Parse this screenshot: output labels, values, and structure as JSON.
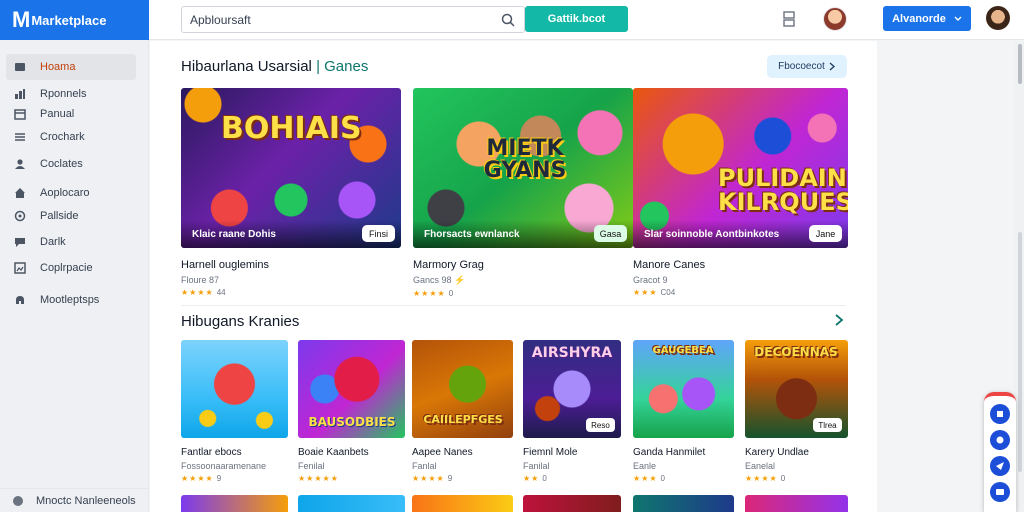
{
  "header": {
    "brand_mark": "M",
    "brand_name": "Marketplace",
    "search_value": "Apbloursaft",
    "green_button": "Gattik.bcot",
    "blue_button": "Alvanorde",
    "colors": {
      "brand": "#1a73e8",
      "teal": "#14b8a6"
    }
  },
  "sidebar": {
    "items": [
      {
        "label": "Hoama",
        "icon": "home-icon",
        "active": true
      },
      {
        "label": "Rponnels",
        "icon": "chart-icon"
      },
      {
        "label": "Panual",
        "icon": "calendar-icon"
      },
      {
        "label": "Crochark",
        "icon": "list-icon"
      },
      {
        "label": "Coclates",
        "icon": "user-icon"
      },
      {
        "label": "Aoplocaro",
        "icon": "house-icon"
      },
      {
        "label": "Pallside",
        "icon": "location-icon"
      },
      {
        "label": "Darlk",
        "icon": "chat-icon"
      },
      {
        "label": "Coplrpacie",
        "icon": "image-icon"
      },
      {
        "label": "Mootleptsps",
        "icon": "cloud-icon"
      }
    ],
    "footer": "Mnoctc Nanleeneols"
  },
  "featured": {
    "title": "Hibaurlana Usarsial",
    "title_accent": "| Ganes",
    "see_all": "Fbocoecot",
    "cards": [
      {
        "art": "BOHIAIS",
        "caption": "Klaic raane Dohis",
        "badge": "Finsi",
        "title": "Harnell ouglemins",
        "sub": "Floure 87",
        "rating": "44",
        "stars": "★★★★"
      },
      {
        "art": "MIETK GYANS",
        "caption": "Fhorsacts ewnlanck",
        "badge": "Gasa",
        "title": "Marmory Grag",
        "sub": "Gancs 98 ⚡",
        "rating": "0",
        "stars": "★★★★"
      },
      {
        "art": "PULIDAIN KILRQUES",
        "caption": "Slar soinnoble Aontbinkotes",
        "badge": "Jane",
        "title": "Manore Canes",
        "sub": "Gracot 9",
        "rating": "C04",
        "stars": "★★★"
      }
    ]
  },
  "games": {
    "title": "Hibugans Kranies",
    "cards": [
      {
        "art": "",
        "title": "Fantlar ebocs",
        "sub": "Fossoonaaramenane",
        "rating": "9",
        "stars": "★★★★"
      },
      {
        "art": "BAUSODBIES",
        "title": "Boaie Kaanbets",
        "sub": "Fenilal",
        "rating": "",
        "stars": "★★★★★"
      },
      {
        "art": "CAIILEPFGES",
        "title": "Aapee Nanes",
        "sub": "Fanlal",
        "rating": "9",
        "stars": "★★★★"
      },
      {
        "art": "AIRSHYRA",
        "badge": "Reso",
        "title": "Fiemnl Mole",
        "sub": "Fanilal",
        "rating": "0",
        "stars": "★★"
      },
      {
        "art": "GAUGEBEA",
        "title": "Ganda Hanmilet",
        "sub": "Eanle",
        "rating": "0",
        "stars": "★★★"
      },
      {
        "art": "DECOENNAS",
        "badge": "Tlrea",
        "title": "Karery Undlae",
        "sub": "Eanelal",
        "rating": "0",
        "stars": "★★★★"
      }
    ]
  }
}
